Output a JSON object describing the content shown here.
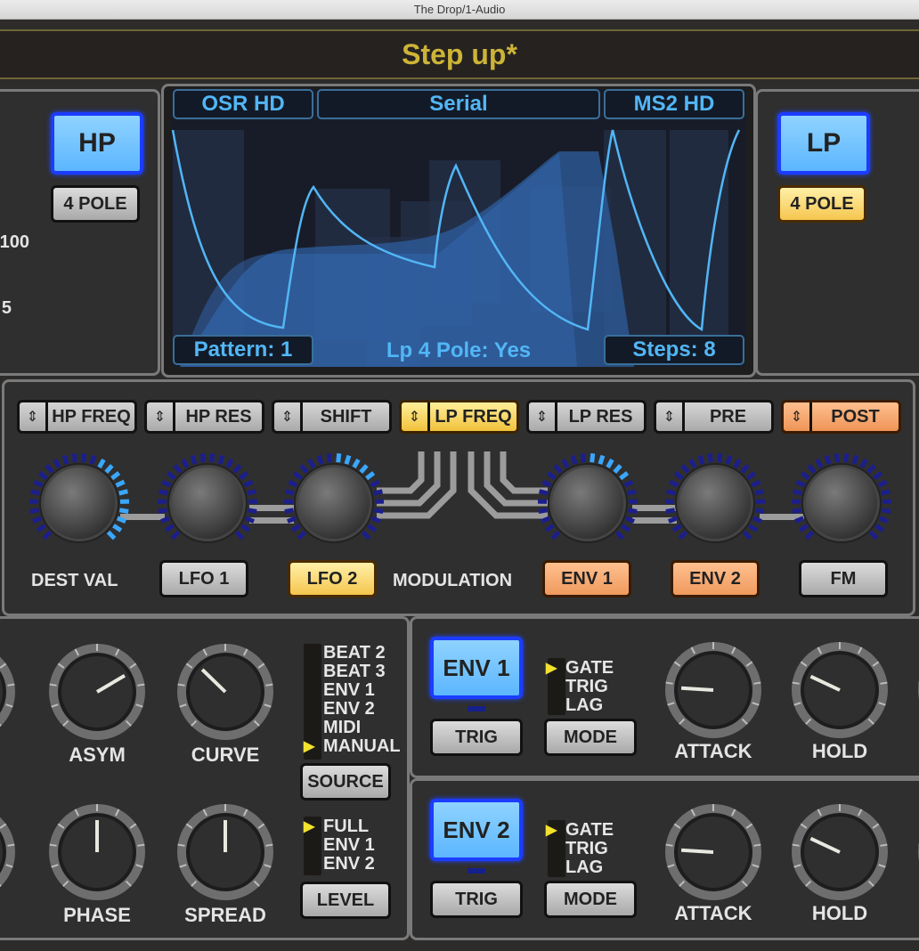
{
  "window": {
    "title": "The Drop/1-Audio"
  },
  "preset": {
    "name": "Step up*"
  },
  "left_panel": {
    "filter_type": "HP",
    "pole_label": "4 POLE",
    "pole_active": false,
    "partial_values": [
      "100",
      "5"
    ]
  },
  "right_panel": {
    "filter_type": "LP",
    "pole_label": "4 POLE",
    "pole_active": true
  },
  "display": {
    "left_mode": "OSR HD",
    "routing": "Serial",
    "right_mode": "MS2 HD",
    "pattern_label": "Pattern: 1",
    "status_text": "Lp 4 Pole: Yes",
    "steps_label": "Steps: 8",
    "colors": {
      "line": "#52b6f5",
      "fill": "#2e5d9e",
      "background": "#181c28"
    }
  },
  "modulation": {
    "destinations": [
      {
        "label": "HP FREQ",
        "state": "gray"
      },
      {
        "label": "HP RES",
        "state": "gray"
      },
      {
        "label": "SHIFT",
        "state": "gray"
      },
      {
        "label": "LP FREQ",
        "state": "yellow"
      },
      {
        "label": "LP RES",
        "state": "gray"
      },
      {
        "label": "PRE",
        "state": "gray"
      },
      {
        "label": "POST",
        "state": "orange"
      }
    ],
    "knobs": [
      {
        "name": "dest-val",
        "lit_fraction": 0.62,
        "lit_start": 0.6
      },
      {
        "name": "lfo1",
        "lit_fraction": 0.0,
        "lit_start": 0.5
      },
      {
        "name": "lfo2",
        "lit_fraction": 0.22,
        "lit_start": 0.5
      },
      {
        "name": "env1",
        "lit_fraction": 0.22,
        "lit_start": 0.5
      },
      {
        "name": "env2",
        "lit_fraction": 0.0,
        "lit_start": 0.5
      },
      {
        "name": "fm",
        "lit_fraction": 0.0,
        "lit_start": 0.5
      }
    ],
    "dest_val_label": "DEST VAL",
    "section_label": "MODULATION",
    "sources": [
      {
        "label": "LFO 1",
        "state": "gray"
      },
      {
        "label": "LFO 2",
        "state": "yellow"
      },
      {
        "label": "ENV 1",
        "state": "orange"
      },
      {
        "label": "ENV 2",
        "state": "orange"
      },
      {
        "label": "FM",
        "state": "gray"
      }
    ]
  },
  "lfo_panel": {
    "knobs": [
      {
        "label": "ASYM",
        "value": 0.72
      },
      {
        "label": "CURVE",
        "value": 0.33
      },
      {
        "label": "PHASE",
        "value": 0.5
      },
      {
        "label": "SPREAD",
        "value": 0.5
      }
    ],
    "source_options": [
      "BEAT 2",
      "BEAT 3",
      "ENV 1",
      "ENV 2",
      "MIDI",
      "MANUAL"
    ],
    "source_selected": "MANUAL",
    "source_button": "SOURCE",
    "level_options": [
      "FULL",
      "ENV 1",
      "ENV 2"
    ],
    "level_selected": "FULL",
    "level_button": "LEVEL"
  },
  "env1_panel": {
    "title": "ENV 1",
    "trig_button": "TRIG",
    "mode_button": "MODE",
    "mode_options": [
      "GATE",
      "TRIG",
      "LAG"
    ],
    "mode_selected": "GATE",
    "knobs": [
      {
        "label": "ATTACK",
        "value": 0.18
      },
      {
        "label": "HOLD",
        "value": 0.26
      }
    ]
  },
  "env2_panel": {
    "title": "ENV 2",
    "trig_button": "TRIG",
    "mode_button": "MODE",
    "mode_options": [
      "GATE",
      "TRIG",
      "LAG"
    ],
    "mode_selected": "GATE",
    "knobs": [
      {
        "label": "ATTACK",
        "value": 0.18
      },
      {
        "label": "HOLD",
        "value": 0.26
      }
    ]
  }
}
